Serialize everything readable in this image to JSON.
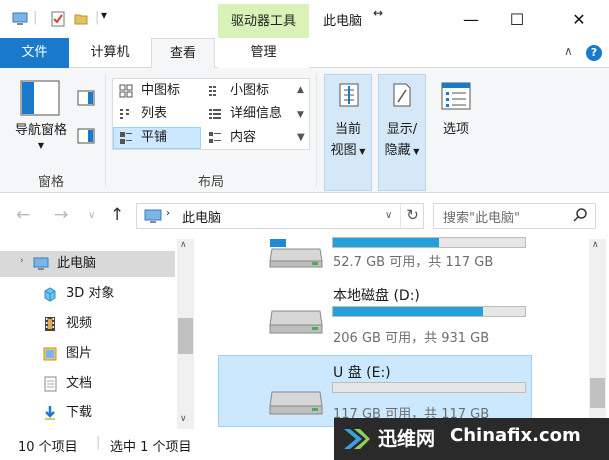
{
  "titlebar": {
    "context_group": "驱动器工具",
    "window_title": "此电脑",
    "pin_glyph": "↔",
    "dropdown_glyph": "▾",
    "minimize": "—",
    "maximize": "☐",
    "close": "✕"
  },
  "tabs": {
    "file": "文件",
    "computer": "计算机",
    "view": "查看",
    "manage": "管理"
  },
  "ribbon": {
    "minimize_glyph": "∧",
    "help_glyph": "?",
    "nav_pane": "导航窗格",
    "pane_group": "窗格",
    "layout_group": "布局",
    "layout": {
      "medium_icons": "中图标",
      "small_icons": "小图标",
      "list": "列表",
      "details": "详细信息",
      "tiles": "平铺",
      "content": "内容"
    },
    "sort_by_line1": "当前",
    "sort_by_line2": "视图",
    "show_hide_line1": "显示/",
    "show_hide_line2": "隐藏",
    "options": "选项"
  },
  "address": {
    "path": "此电脑",
    "search_placeholder": "搜索\"此电脑\""
  },
  "nav": {
    "this_pc": "此电脑",
    "objects_3d": "3D 对象",
    "videos": "视频",
    "pictures": "图片",
    "documents": "文档",
    "downloads": "下载"
  },
  "drives": [
    {
      "name": "",
      "space": "52.7 GB 可用，共 117 GB",
      "used_fraction": 0.55
    },
    {
      "name": "本地磁盘 (D:)",
      "space": "206 GB 可用，共 931 GB",
      "used_fraction": 0.78
    },
    {
      "name": "U 盘 (E:)",
      "space": "117 GB 可用，共 117 GB",
      "used_fraction": 0.0
    }
  ],
  "status": {
    "item_count": "10 个项目",
    "selected": "选中 1 个项目"
  },
  "watermark": {
    "cn": "迅维网",
    "en": "Chinafix.com"
  }
}
